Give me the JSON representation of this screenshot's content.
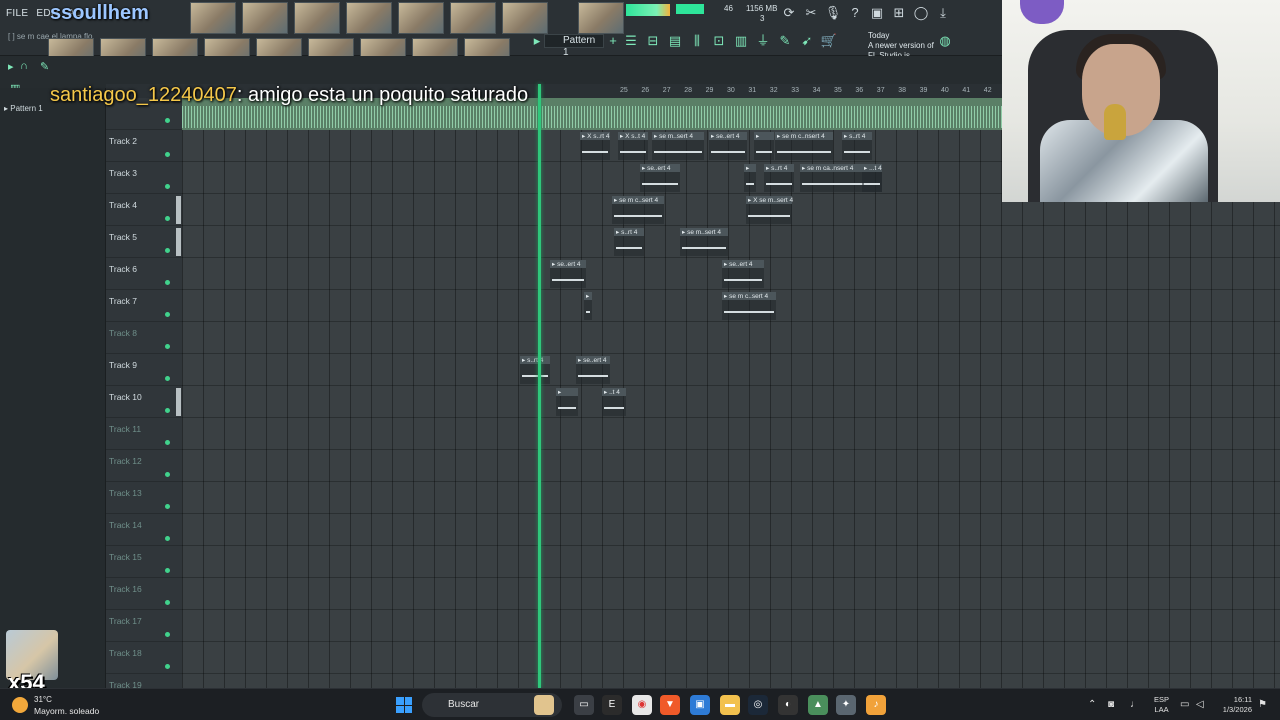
{
  "menu": [
    "FILE",
    "EDIT",
    "AD"
  ],
  "streamer_name": "ssoullhem",
  "browser_hint": "[ ] se m cae el lampa flo",
  "toolbar": {
    "tempo": "46",
    "memory": "1156 MB",
    "memory_sub": "3",
    "pattern_label": "Pattern 1",
    "update_today": "Today",
    "update_msg": "A newer version of FL Studio is available!"
  },
  "left_panel": {
    "pattern_item": "Pattern 1"
  },
  "ruler_ticks": [
    "25",
    "26",
    "27",
    "28",
    "29",
    "30",
    "31",
    "32",
    "33",
    "34",
    "35",
    "36",
    "37",
    "38",
    "39",
    "40",
    "41",
    "42",
    "43"
  ],
  "chat": {
    "user": "santiagoo_12240407",
    "message": "amigo esta un poquito saturado"
  },
  "tracks": [
    {
      "name": "Track 2",
      "dim": false
    },
    {
      "name": "Track 3",
      "dim": false
    },
    {
      "name": "Track 4",
      "dim": false
    },
    {
      "name": "Track 5",
      "dim": false
    },
    {
      "name": "Track 6",
      "dim": false
    },
    {
      "name": "Track 7",
      "dim": false
    },
    {
      "name": "Track 8",
      "dim": true
    },
    {
      "name": "Track 9",
      "dim": false
    },
    {
      "name": "Track 10",
      "dim": false
    },
    {
      "name": "Track 11",
      "dim": true
    },
    {
      "name": "Track 12",
      "dim": true
    },
    {
      "name": "Track 13",
      "dim": true
    },
    {
      "name": "Track 14",
      "dim": true
    },
    {
      "name": "Track 15",
      "dim": true
    },
    {
      "name": "Track 16",
      "dim": true
    },
    {
      "name": "Track 17",
      "dim": true
    },
    {
      "name": "Track 18",
      "dim": true
    },
    {
      "name": "Track 19",
      "dim": true
    }
  ],
  "clips": [
    {
      "track": 0,
      "label": "X s..rt 4"
    },
    {
      "track": 0,
      "label": "X s..t 4"
    },
    {
      "track": 0,
      "label": "se m..sert 4"
    },
    {
      "track": 0,
      "label": "se..ert 4"
    },
    {
      "track": 0,
      "label": ""
    },
    {
      "track": 0,
      "label": "se m c..nsert 4"
    },
    {
      "track": 0,
      "label": "s..rt 4"
    },
    {
      "track": 1,
      "label": "se..ert 4"
    },
    {
      "track": 1,
      "label": ""
    },
    {
      "track": 1,
      "label": "s..rt 4"
    },
    {
      "track": 1,
      "label": "se m ca..nsert 4"
    },
    {
      "track": 1,
      "label": "...t 4"
    },
    {
      "track": 2,
      "label": "se m c..sert 4"
    },
    {
      "track": 2,
      "label": "X se m..sert 4"
    },
    {
      "track": 3,
      "label": "s..rt 4"
    },
    {
      "track": 3,
      "label": "se m..sert 4"
    },
    {
      "track": 4,
      "label": "se..ert 4"
    },
    {
      "track": 4,
      "label": "se..ert 4"
    },
    {
      "track": 5,
      "label": ""
    },
    {
      "track": 5,
      "label": "se m c..sert 4"
    },
    {
      "track": 7,
      "label": "s..rt 4"
    },
    {
      "track": 7,
      "label": "se..ert 4"
    },
    {
      "track": 8,
      "label": ""
    },
    {
      "track": 8,
      "label": "..t 4"
    }
  ],
  "gift_count": "x54",
  "taskbar": {
    "temp": "31°C",
    "weather": "Mayorm. soleado",
    "search": "Buscar",
    "lang_top": "ESP",
    "lang_bottom": "LAA",
    "time": "16:11",
    "date": "1/3/2026"
  }
}
